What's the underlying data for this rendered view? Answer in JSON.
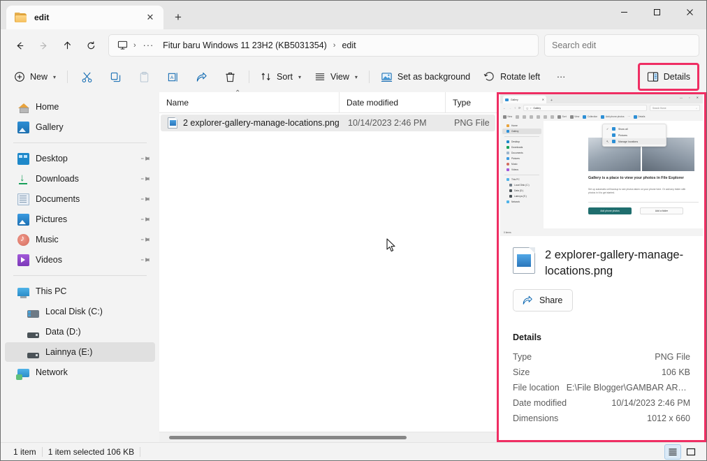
{
  "window": {
    "tab_label": "edit",
    "tab_close_label": "✕",
    "new_tab_label": "+",
    "minimize_label": "—",
    "maximize_label": "▢",
    "close_label": "✕"
  },
  "nav": {
    "back_label": "←",
    "forward_label": "→",
    "up_label": "↑",
    "refresh_label": "⟳",
    "breadcrumb": {
      "pc_icon": "this-pc-icon",
      "sep": "›",
      "overflow": "···",
      "items": [
        "Fitur baru Windows 11 23H2 (KB5031354)",
        "edit"
      ]
    },
    "search_placeholder": "Search edit"
  },
  "toolbar": {
    "new_label": "New",
    "cut_label": "Cut",
    "copy_label": "Copy",
    "paste_label": "Paste",
    "rename_label": "Rename",
    "share_label": "Share",
    "delete_label": "Delete",
    "sort_label": "Sort",
    "view_label": "View",
    "set_as_background_label": "Set as background",
    "rotate_left_label": "Rotate left",
    "more_label": "···",
    "details_label": "Details",
    "chevron": "⌄",
    "highlight_color": "#ef2e63"
  },
  "sidebar": {
    "groups": [
      {
        "items": [
          {
            "label": "Home",
            "icon": "home-icon",
            "pinned": false,
            "selected": false,
            "indent": false
          },
          {
            "label": "Gallery",
            "icon": "gallery-icon",
            "pinned": false,
            "selected": false,
            "indent": false
          }
        ]
      },
      {
        "items": [
          {
            "label": "Desktop",
            "icon": "desktop-icon",
            "pinned": true,
            "selected": false,
            "indent": false
          },
          {
            "label": "Downloads",
            "icon": "downloads-icon",
            "pinned": true,
            "selected": false,
            "indent": false
          },
          {
            "label": "Documents",
            "icon": "documents-icon",
            "pinned": true,
            "selected": false,
            "indent": false
          },
          {
            "label": "Pictures",
            "icon": "pictures-icon",
            "pinned": true,
            "selected": false,
            "indent": false
          },
          {
            "label": "Music",
            "icon": "music-icon",
            "pinned": true,
            "selected": false,
            "indent": false
          },
          {
            "label": "Videos",
            "icon": "videos-icon",
            "pinned": true,
            "selected": false,
            "indent": false
          }
        ]
      },
      {
        "items": [
          {
            "label": "This PC",
            "icon": "this-pc-icon",
            "pinned": false,
            "selected": false,
            "indent": false
          },
          {
            "label": "Local Disk (C:)",
            "icon": "local-disk-icon",
            "pinned": false,
            "selected": false,
            "indent": true
          },
          {
            "label": "Data (D:)",
            "icon": "drive-icon",
            "pinned": false,
            "selected": false,
            "indent": true
          },
          {
            "label": "Lainnya (E:)",
            "icon": "drive-icon",
            "pinned": false,
            "selected": true,
            "indent": true
          },
          {
            "label": "Network",
            "icon": "network-icon",
            "pinned": false,
            "selected": false,
            "indent": false
          }
        ]
      }
    ],
    "pin_glyph": "📌"
  },
  "filelist": {
    "columns": [
      "Name",
      "Date modified",
      "Type"
    ],
    "sort_indicator": "⌃",
    "rows": [
      {
        "name": "2 explorer-gallery-manage-locations.png",
        "date_modified": "10/14/2023 2:46 PM",
        "type": "PNG File",
        "selected": true
      }
    ]
  },
  "details_pane": {
    "preview": {
      "tab_label": "Gallery",
      "new_tab_label": "+",
      "breadcrumb": "Gallery",
      "search_placeholder": "Search Home",
      "commands": [
        "New",
        "Sort",
        "View",
        "Collection",
        "Add phone photos",
        "···",
        "Details"
      ],
      "sidebar": [
        "Home",
        "Gallery",
        "Desktop",
        "Downloads",
        "Documents",
        "Pictures",
        "Music",
        "Videos",
        "This PC",
        "Local Disk (C:)",
        "Data (D:)",
        "Lainnya (E:)",
        "Network"
      ],
      "menu_items": [
        "Show all",
        "Pictures",
        "Manage locations"
      ],
      "heading": "Gallery is a place to view your photos in File Explorer",
      "paragraph": "Set up automatic cell backup to see photos taken on your phone here. Or add any folder with photos in it to get started.",
      "primary_button": "Add phone photos",
      "secondary_button": "Add a folder",
      "status": "0 items"
    },
    "filename": "2 explorer-gallery-manage-locations.png",
    "share_label": "Share",
    "section_title": "Details",
    "rows": [
      {
        "key": "Type",
        "value": "PNG File"
      },
      {
        "key": "Size",
        "value": "106 KB"
      },
      {
        "key": "File location",
        "value": "E:\\File Blogger\\GAMBAR ARTI..."
      },
      {
        "key": "Date modified",
        "value": "10/14/2023 2:46 PM"
      },
      {
        "key": "Dimensions",
        "value": "1012 x 660"
      }
    ],
    "highlight_color": "#ef2e63"
  },
  "statusbar": {
    "item_count": "1 item",
    "selection": "1 item selected  106 KB",
    "view_list_label": "List view",
    "view_tiles_label": "Details view"
  }
}
